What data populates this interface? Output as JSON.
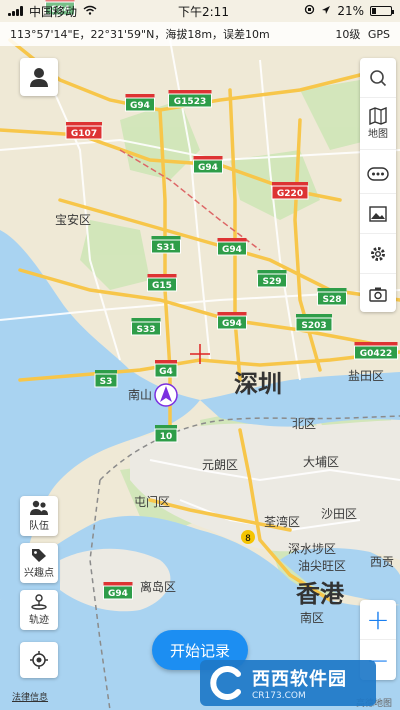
{
  "status_bar": {
    "carrier": "中国移动",
    "time": "下午2:11",
    "battery_percent": "21%",
    "battery_level": 0.21
  },
  "info_bar": {
    "location": "113°57'14\"E，22°31'59\"N，海拔18m，误差10m",
    "zoom_level": "10级",
    "gps": "GPS"
  },
  "controls": {
    "map_label": "地图",
    "team_label": "队伍",
    "poi_label": "兴趣点",
    "track_label": "轨迹",
    "zoom_in": "+",
    "zoom_out": "−",
    "start_record": "开始记录",
    "legal": "法律信息",
    "map_provider": "高德地图"
  },
  "watermark": {
    "title": "西西软件园",
    "url": "CR173.COM"
  },
  "map": {
    "places": {
      "baoan": "宝安区",
      "shenzhen": "深圳",
      "nanshan": "南山",
      "yantian": "盐田区",
      "north": "北区",
      "yuenlong": "元朗区",
      "taipo": "大埔区",
      "tuenmun": "屯门区",
      "shatin": "沙田区",
      "tsuenwan": "荃湾区",
      "shamshuipo": "深水埗区",
      "yautsim": "油尖旺区",
      "saikung": "西贡",
      "hongkong": "香港",
      "islands": "离岛区",
      "southern": "南区"
    },
    "roads": {
      "g94_top": "G94",
      "g1523": "G1523",
      "g107": "G107",
      "g94_mid": "G94",
      "g220": "G220",
      "s31": "S31",
      "g94_c": "G94",
      "s29": "S29",
      "g15": "G15",
      "s28": "S28",
      "s33": "S33",
      "g94_low": "G94",
      "s203": "S203",
      "g0422": "G0422",
      "s3": "S3",
      "g4": "G4",
      "r10": "10",
      "r8": "8",
      "g94_bottom": "G94"
    }
  },
  "colors": {
    "land": "#efe9d6",
    "urban": "#e8e1cf",
    "green": "#cde6b8",
    "water": "#a9d3f1",
    "highway": "#f7c64a",
    "accent": "#1c8ef2",
    "shield_green": "#2e9d49"
  }
}
